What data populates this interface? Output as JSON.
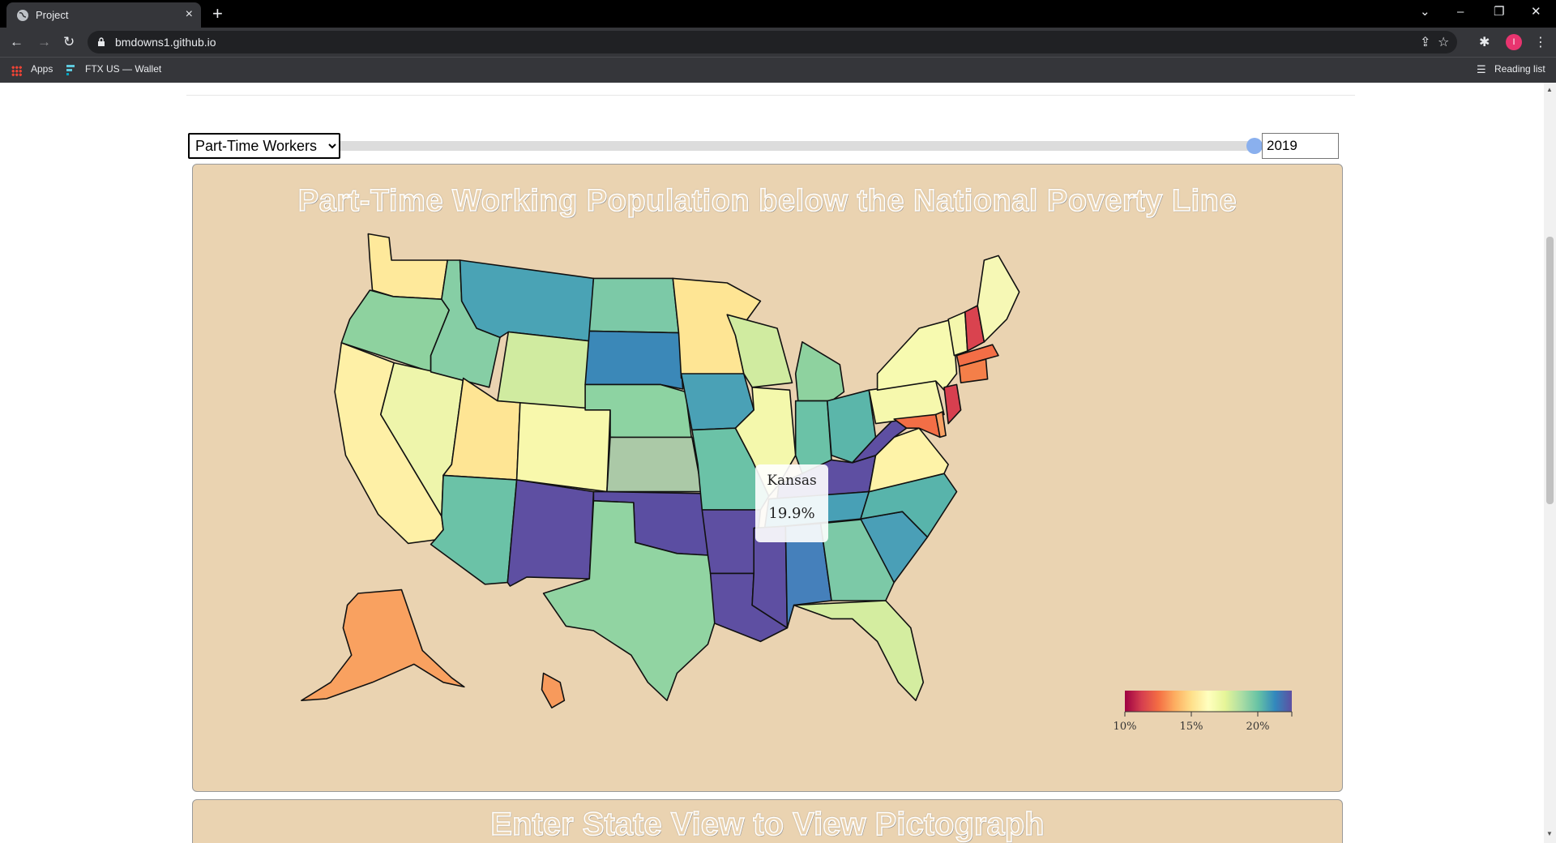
{
  "browser": {
    "tab_title": "Project",
    "url": "bmdowns1.github.io",
    "bookmarks": [
      {
        "label": "Apps"
      },
      {
        "label": "FTX US — Wallet"
      }
    ],
    "reading_list": "Reading list",
    "profile_initial": "I"
  },
  "controls": {
    "measure_options": [
      "Part-Time Workers"
    ],
    "measure_selected": "Part-Time Workers",
    "year_value": "2019",
    "slider_position": 1.0
  },
  "map": {
    "title": "Part-Time Working Population below the National Poverty Line",
    "tooltip": {
      "state": "Kansas",
      "value": "19.9%"
    },
    "legend": {
      "colors": [
        "#9e0142",
        "#d53e4f",
        "#f46d43",
        "#fdae61",
        "#fee08b",
        "#ffffbf",
        "#e6f598",
        "#abdda4",
        "#66c2a5",
        "#3288bd",
        "#5e4fa2"
      ],
      "ticks": [
        "10%",
        "15%",
        "20%"
      ]
    },
    "states": [
      {
        "name": "Washington",
        "color": "#fee99b"
      },
      {
        "name": "Oregon",
        "color": "#8ed29f"
      },
      {
        "name": "California",
        "color": "#fef0a6"
      },
      {
        "name": "Nevada",
        "color": "#eef5ab"
      },
      {
        "name": "Idaho",
        "color": "#86cea5"
      },
      {
        "name": "Montana",
        "color": "#4aa3b5"
      },
      {
        "name": "Wyoming",
        "color": "#d0eba0"
      },
      {
        "name": "Utah",
        "color": "#fee594"
      },
      {
        "name": "Arizona",
        "color": "#6bc2a7"
      },
      {
        "name": "Colorado",
        "color": "#f8f8ac"
      },
      {
        "name": "New Mexico",
        "color": "#5e4fa2"
      },
      {
        "name": "North Dakota",
        "color": "#7cc9a7"
      },
      {
        "name": "South Dakota",
        "color": "#3b88b8"
      },
      {
        "name": "Nebraska",
        "color": "#8dd3a2"
      },
      {
        "name": "Kansas",
        "color": "#abc9a7"
      },
      {
        "name": "Oklahoma",
        "color": "#5b4ea2"
      },
      {
        "name": "Texas",
        "color": "#91d4a2"
      },
      {
        "name": "Minnesota",
        "color": "#fee594"
      },
      {
        "name": "Iowa",
        "color": "#4aa1b6"
      },
      {
        "name": "Missouri",
        "color": "#6bc2a7"
      },
      {
        "name": "Arkansas",
        "color": "#5e4fa2"
      },
      {
        "name": "Louisiana",
        "color": "#5e4fa2"
      },
      {
        "name": "Wisconsin",
        "color": "#d0eba0"
      },
      {
        "name": "Illinois",
        "color": "#f4f8ac"
      },
      {
        "name": "Michigan",
        "color": "#8ed29f"
      },
      {
        "name": "Indiana",
        "color": "#6bc2a7"
      },
      {
        "name": "Ohio",
        "color": "#5bb6aa"
      },
      {
        "name": "Kentucky",
        "color": "#5e4fa2"
      },
      {
        "name": "Tennessee",
        "color": "#48a0b6"
      },
      {
        "name": "Mississippi",
        "color": "#5e4fa2"
      },
      {
        "name": "Alabama",
        "color": "#4580bb"
      },
      {
        "name": "Georgia",
        "color": "#7cc9a7"
      },
      {
        "name": "Florida",
        "color": "#d4eda0"
      },
      {
        "name": "South Carolina",
        "color": "#4a9fb7"
      },
      {
        "name": "North Carolina",
        "color": "#58b4ab"
      },
      {
        "name": "Virginia",
        "color": "#fef3a8"
      },
      {
        "name": "West Virginia",
        "color": "#5e4fa2"
      },
      {
        "name": "Pennsylvania",
        "color": "#f6f8ad"
      },
      {
        "name": "New York",
        "color": "#f7fab0"
      },
      {
        "name": "Vermont",
        "color": "#f4f7ad"
      },
      {
        "name": "New Hampshire",
        "color": "#d9434f"
      },
      {
        "name": "Maine",
        "color": "#f6f8b5"
      },
      {
        "name": "Massachusetts",
        "color": "#f36e46"
      },
      {
        "name": "Connecticut",
        "color": "#f47f49"
      },
      {
        "name": "New Jersey",
        "color": "#d73f4f"
      },
      {
        "name": "Maryland",
        "color": "#f36e46"
      },
      {
        "name": "Delaware",
        "color": "#f8a063"
      },
      {
        "name": "Alaska",
        "color": "#f9a160"
      },
      {
        "name": "Hawaii",
        "color": "#f79a5c"
      }
    ]
  },
  "pictograph": {
    "title": "Enter State View to View Pictograph"
  }
}
